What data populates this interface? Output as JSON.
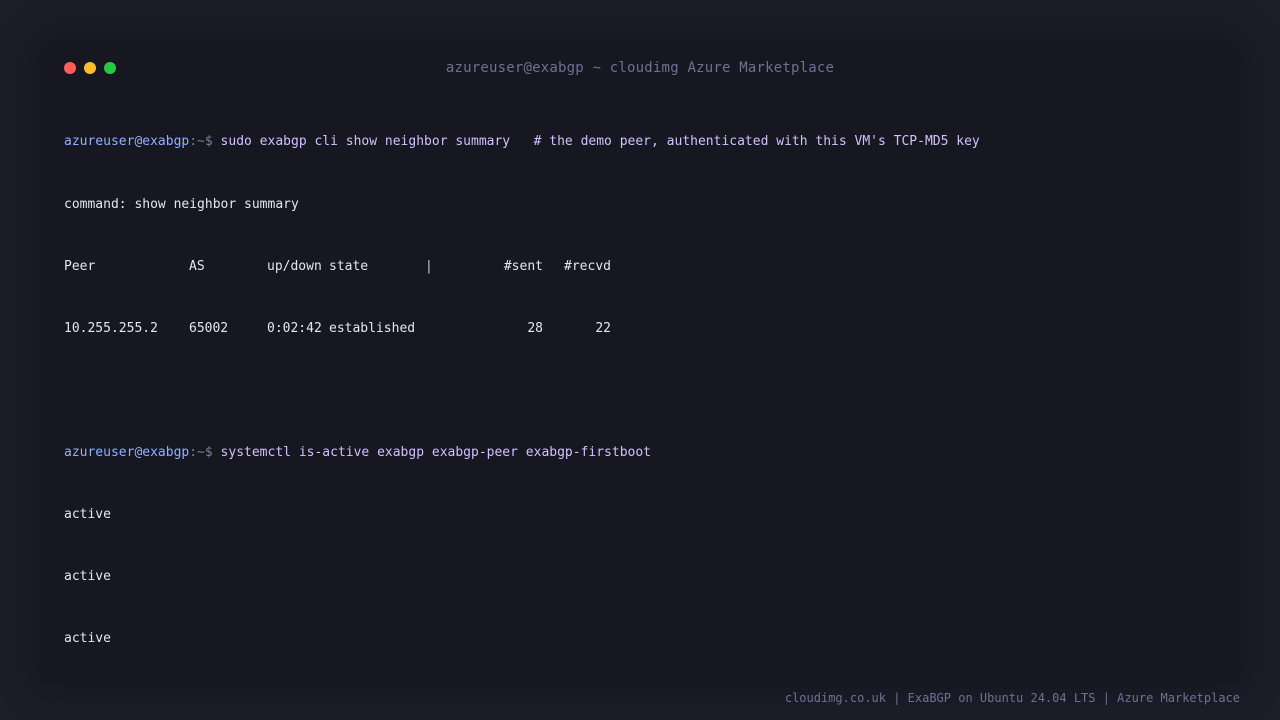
{
  "window": {
    "title": "azureuser@exabgp ~ cloudimg Azure Marketplace"
  },
  "terminal": {
    "prompt_user": "azureuser@exabgp",
    "prompt_path": ":~$",
    "cmd1": "sudo exabgp cli show neighbor summary   # the demo peer, authenticated with this VM's TCP-MD5 key",
    "out_command": "command: show neighbor summary",
    "table": {
      "headers": {
        "peer": "Peer",
        "as": "AS",
        "updown": "up/down",
        "state": "state",
        "sep": "|",
        "sent": "#sent",
        "recvd": "#recvd"
      },
      "rows": [
        {
          "peer": "10.255.255.2",
          "as": "65002",
          "updown": "0:02:42",
          "state": "established",
          "sent": "28",
          "recvd": "22"
        }
      ]
    },
    "cmd2": "systemctl is-active exabgp exabgp-peer exabgp-firstboot",
    "statuses": [
      "active",
      "active",
      "active"
    ]
  },
  "footer": {
    "text": "cloudimg.co.uk | ExaBGP on Ubuntu 24.04 LTS | Azure Marketplace"
  },
  "colors": {
    "background": "#1c1d29",
    "window": "#161721",
    "prompt_user": "#8fb0ff",
    "command": "#d2c1ff",
    "close": "#ff5f57",
    "minimize": "#febc2e",
    "maximize": "#28c840"
  }
}
